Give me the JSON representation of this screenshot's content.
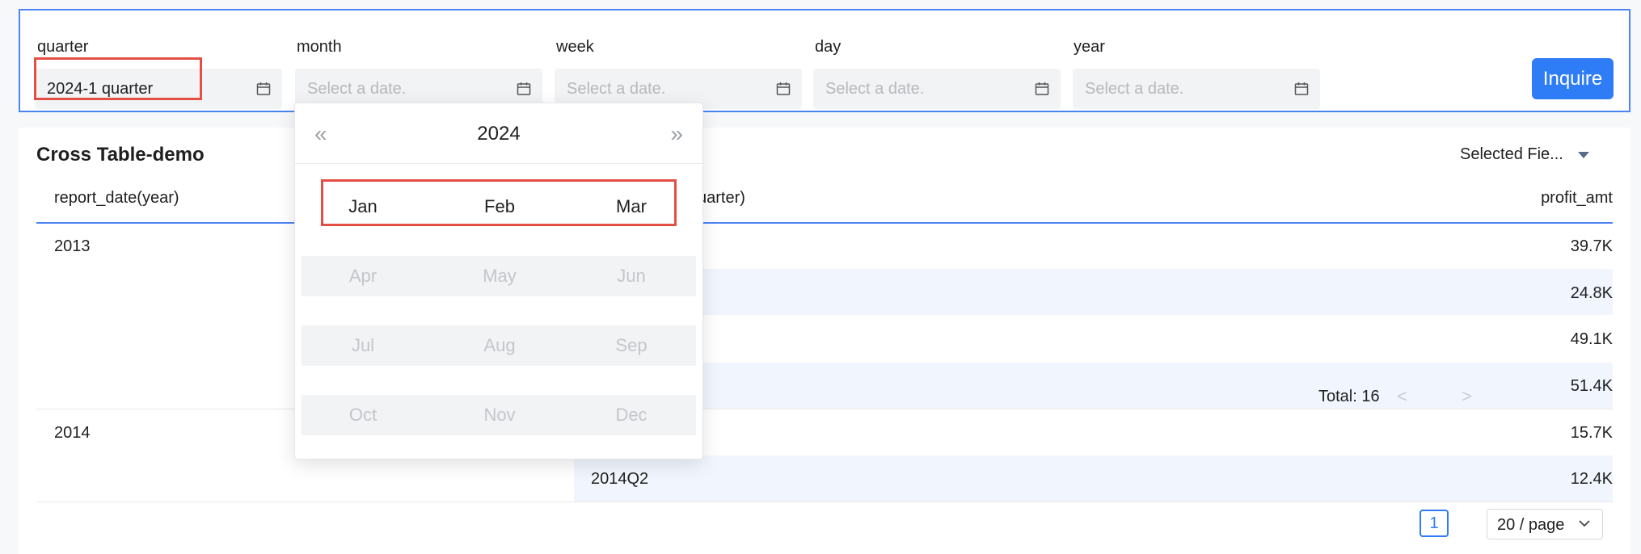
{
  "filters": {
    "quarter": {
      "label": "quarter",
      "value": "2024-1 quarter"
    },
    "month": {
      "label": "month",
      "placeholder": "Select a date."
    },
    "week": {
      "label": "week",
      "placeholder": "Select a date."
    },
    "day": {
      "label": "day",
      "placeholder": "Select a date."
    },
    "year": {
      "label": "year",
      "placeholder": "Select a date."
    },
    "inquire_label": "Inquire"
  },
  "table": {
    "title": "Cross Table-demo",
    "selected_fields": "Selected Fie...",
    "headers": {
      "col1": "report_date(year)",
      "col2": "uarter)",
      "col3": "profit_amt"
    },
    "rows": [
      {
        "year": "2013",
        "quarter": "",
        "profit": "39.7K"
      },
      {
        "year": "",
        "quarter": "",
        "profit": "24.8K"
      },
      {
        "year": "",
        "quarter": "",
        "profit": "49.1K"
      },
      {
        "year": "",
        "quarter": "",
        "profit": "51.4K"
      },
      {
        "year": "2014",
        "quarter": "",
        "profit": "15.7K"
      },
      {
        "year": "",
        "quarter": "2014Q2",
        "profit": "12.4K"
      }
    ]
  },
  "pagination": {
    "total": "Total: 16",
    "prev": "<",
    "current_page": "1",
    "next": ">",
    "page_size": "20 / page"
  },
  "picker": {
    "year": "2024",
    "prev": "«",
    "next": "»",
    "months": [
      "Jan",
      "Feb",
      "Mar",
      "Apr",
      "May",
      "Jun",
      "Jul",
      "Aug",
      "Sep",
      "Oct",
      "Nov",
      "Dec"
    ]
  },
  "colors": {
    "accent": "#2e7cf6",
    "highlight": "#e54e45",
    "row_stripe": "#f1f5fd"
  }
}
